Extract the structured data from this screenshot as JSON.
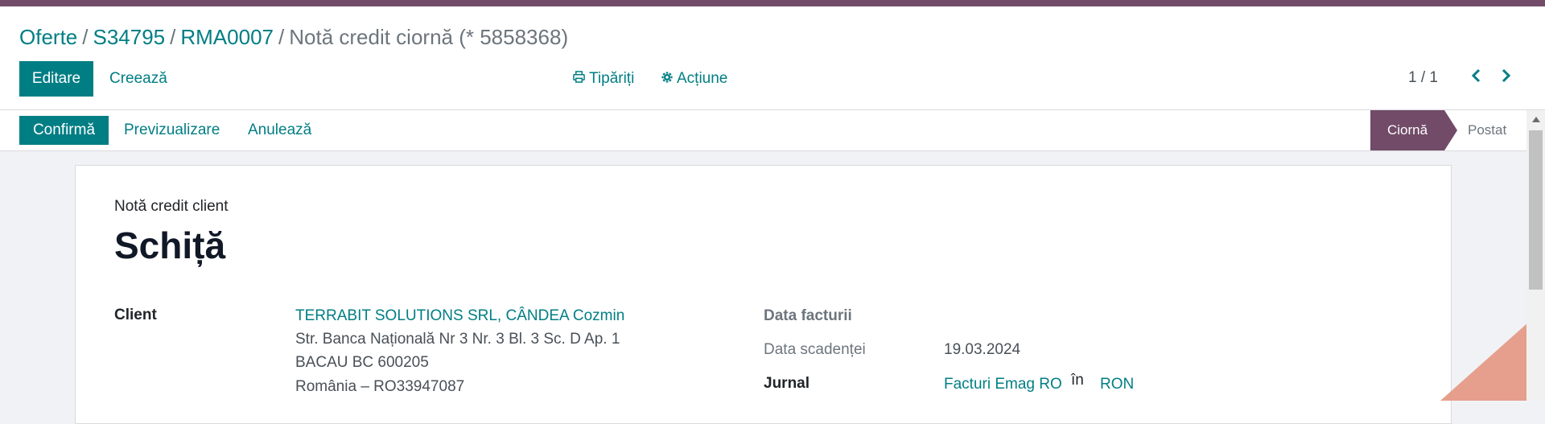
{
  "breadcrumb": {
    "items": [
      "Oferte",
      "S34795",
      "RMA0007"
    ],
    "separator": "/",
    "current": "Notă credit ciornă (* 5858368)"
  },
  "toolbar": {
    "edit_label": "Editare",
    "create_label": "Creează",
    "print_label": "Tipăriți",
    "action_label": "Acțiune"
  },
  "pager": {
    "value": "1 / 1"
  },
  "status_actions": {
    "confirm_label": "Confirmă",
    "preview_label": "Previzualizare",
    "cancel_label": "Anulează"
  },
  "status_stages": {
    "current": "Ciornă",
    "next": "Postat"
  },
  "form": {
    "subtitle": "Notă credit client",
    "title": "Schiță",
    "client_label": "Client",
    "client_name": "TERRABIT SOLUTIONS SRL, CÂNDEA Cozmin",
    "address_line1": "Str. Banca Națională Nr 3 Nr. 3 Bl. 3 Sc. D Ap. 1",
    "address_line2": "BACAU BC 600205",
    "address_line3": "România – RO33947087",
    "invoice_date_label": "Data facturii",
    "due_date_label": "Data scadenței",
    "due_date_value": "19.03.2024",
    "journal_label": "Jurnal",
    "journal_value": "Facturi Emag RO",
    "journal_in": "în",
    "currency_value": "RON"
  },
  "colors": {
    "brand": "#714b67",
    "primary": "#017e84"
  }
}
